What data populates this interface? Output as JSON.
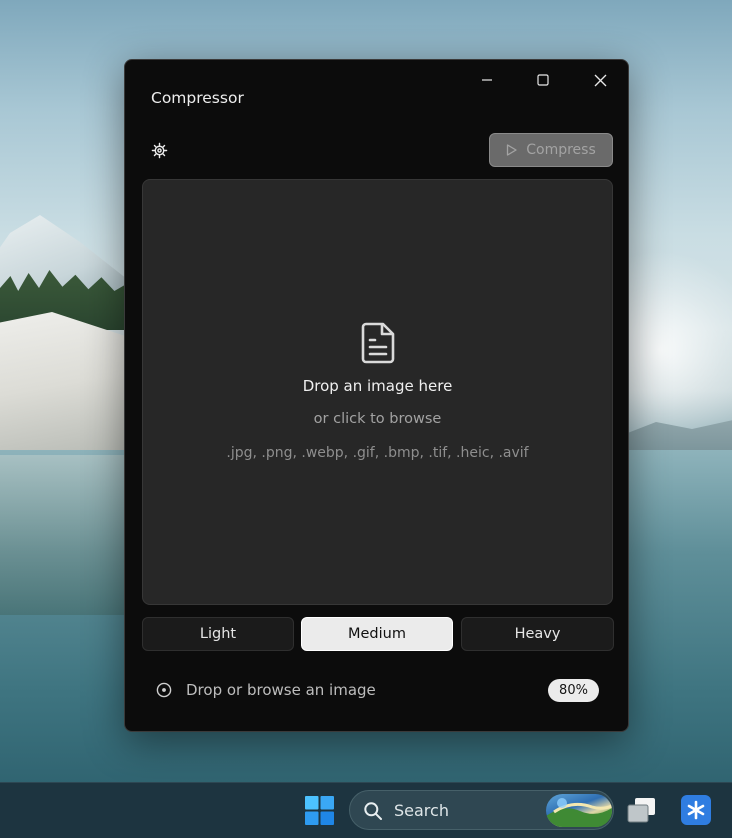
{
  "window": {
    "title": "Compressor"
  },
  "toolbar": {
    "settings_icon": "gear-icon",
    "compress_label": "Compress",
    "compress_icon": "play-icon"
  },
  "dropzone": {
    "icon": "file-text-icon",
    "title": "Drop an image here",
    "subtitle": "or click to browse",
    "formats": ".jpg, .png, .webp, .gif, .bmp, .tif, .heic, .avif"
  },
  "levels": {
    "options": [
      "Light",
      "Medium",
      "Heavy"
    ],
    "selected": "Medium"
  },
  "status": {
    "icon": "target-icon",
    "text": "Drop or browse an image",
    "quality": "80%"
  },
  "taskbar": {
    "search_label": "Search"
  },
  "colors": {
    "window_bg": "#0c0c0c",
    "dropzone_bg": "#272727",
    "selected_level_bg": "#ebebeb",
    "compress_disabled_bg": "#6a6a6a",
    "taskbar_bg": "#1d3440",
    "app_icon_bg": "#2f7de1"
  }
}
